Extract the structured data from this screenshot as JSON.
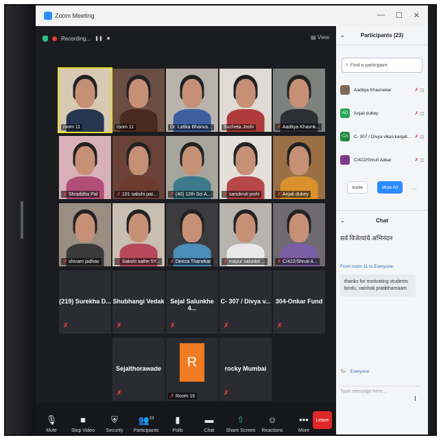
{
  "window": {
    "title": "Zoom Meeting",
    "controls": [
      "—",
      "☐",
      "✕"
    ]
  },
  "recording": {
    "label": "Recording...",
    "pause": "❚❚",
    "stop": "■"
  },
  "view": {
    "label": "▤ View"
  },
  "tiles": [
    {
      "name": "room 11",
      "muted": false,
      "active": true,
      "bg": "#d7c9b2",
      "shirt": "#27364f"
    },
    {
      "name": "room 11",
      "muted": false,
      "active": false,
      "bg": "#6b4e43",
      "shirt": "#4a2a1e"
    },
    {
      "name": "Dr. Latika Bhanus...",
      "muted": false,
      "active": false,
      "bg": "#b9b3ab",
      "shirt": "#3d5fa0"
    },
    {
      "name": "Sucheta Joshi",
      "muted": false,
      "active": false,
      "bg": "#dfdbd4",
      "shirt": "#b13a3a"
    },
    {
      "name": "Aaditya Khavnk...",
      "muted": true,
      "active": false,
      "bg": "#7f817f",
      "shirt": "#2d2f35"
    },
    {
      "name": "Shraddha Pal",
      "muted": true,
      "active": false,
      "bg": "#d8b0b8",
      "shirt": "#b24f79"
    },
    {
      "name": "101 sakshi pat...",
      "muted": true,
      "active": false,
      "bg": "#6b4237",
      "shirt": "#6d3b2f"
    },
    {
      "name": "(40) 12th Sci A...",
      "muted": true,
      "active": false,
      "bg": "#a6a69c",
      "shirt": "#3c7a8c"
    },
    {
      "name": "sanskruti joshi",
      "muted": true,
      "active": false,
      "bg": "#e3e0da",
      "shirt": "#b8474a"
    },
    {
      "name": "Anjali dubey",
      "muted": true,
      "active": false,
      "bg": "#9b6f45",
      "shirt": "#d8912b"
    },
    {
      "name": "shivam jadhav",
      "muted": true,
      "active": false,
      "bg": "#9a8e83",
      "shirt": "#3a3a3a"
    },
    {
      "name": "Sakshi sathe 5Y...",
      "muted": true,
      "active": false,
      "bg": "#c9beb2",
      "shirt": "#b8485b"
    },
    {
      "name": "Deeza Thanekar",
      "muted": true,
      "active": false,
      "bg": "#3b3b40",
      "shirt": "#4a8db8"
    },
    {
      "name": "mayur salunke ...",
      "muted": true,
      "active": false,
      "bg": "#b7b3ad",
      "shirt": "#e8e8e8"
    },
    {
      "name": "C/422/Shruti A...",
      "muted": true,
      "active": false,
      "bg": "#6e6a70",
      "shirt": "#7a5ea4"
    }
  ],
  "name_tiles": [
    {
      "name": "(219) Surekha D..."
    },
    {
      "name": "Shubhangi Vedak"
    },
    {
      "name": "Sejal Salunkhe 4..."
    },
    {
      "name": "C- 307 / Divya v..."
    },
    {
      "name": "304-Onkar Fund"
    },
    {
      "name": "Sejalthorawade"
    },
    {
      "name": "rocky Mumbai"
    }
  ],
  "room16": {
    "letter": "R",
    "name": "Room 16",
    "color": "#f07b22"
  },
  "toolbar": {
    "mute": "Mute",
    "stop_video": "Stop Video",
    "security": "Security",
    "participants": "Participants",
    "participants_count": "23",
    "polls": "Polls",
    "chat": "Chat",
    "share_screen": "Share Screen",
    "reactions": "Reactions",
    "more": "More",
    "leave": "Leave"
  },
  "panel": {
    "participants_title": "Participants (23)",
    "find_placeholder": "Find a participant",
    "participants": [
      {
        "name": "Aaditya Khavnekar",
        "initials": "",
        "color": "#7b6a5c"
      },
      {
        "name": "Anjali dubey",
        "initials": "AD",
        "color": "#26a65b"
      },
      {
        "name": "C- 307 / Divya vikas kargatkar",
        "initials": "C3",
        "color": "#1f8a3f"
      },
      {
        "name": "C/422/Shruti Adkar",
        "initials": "",
        "color": "#7a3b8a"
      }
    ],
    "invite": "Invite",
    "mute_all": "Mute All",
    "more": "...",
    "chat_title": "Chat",
    "chat_message1": "सर्व विजेत्यांचे अभिनंदन",
    "chat_from": "From room 11 to Everyone:",
    "chat_message2": "thanks for motivating students bindu, vaishali pratibhamaam",
    "to_label": "To:",
    "to_value": "Everyone",
    "input_placeholder": "Type message here..."
  }
}
